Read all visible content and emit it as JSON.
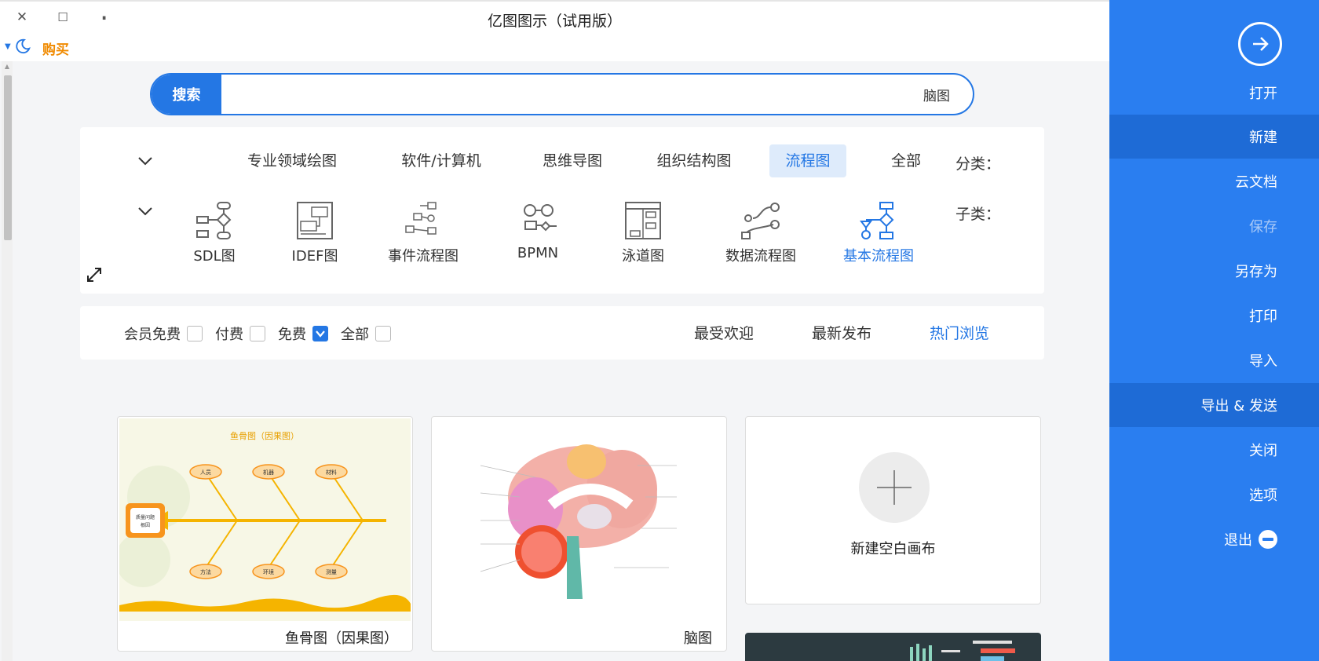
{
  "window": {
    "title": "亿图图示（试用版）",
    "close_glyph": "✕",
    "maximize_glyph": "☐",
    "minimize_glyph": "▬"
  },
  "menu": {
    "buy_label": "购买",
    "theme_icon": "moon-icon"
  },
  "search": {
    "button_label": "搜索",
    "value": "脑图"
  },
  "category": {
    "label": "分类：",
    "items": [
      "全部",
      "流程图",
      "组织结构图",
      "思维导图",
      "软件/计算机",
      "专业领域绘图"
    ],
    "active": "流程图"
  },
  "subcategory": {
    "label": "子类：",
    "items": [
      "基本流程图",
      "数据流程图",
      "泳道图",
      "BPMN",
      "事件流程图",
      "IDEF图",
      "SDL图"
    ],
    "active": "基本流程图"
  },
  "sort": {
    "items": [
      "热门浏览",
      "最新发布",
      "最受欢迎"
    ],
    "active": "热门浏览"
  },
  "price_filter": {
    "items": [
      "全部",
      "免费",
      "付费",
      "会员免费"
    ],
    "checked": "免费"
  },
  "cards": {
    "new_blank": "新建空白画布",
    "brain": "脑图",
    "fishbone": "鱼骨图（因果图）",
    "fishbone_title": "鱼骨图（因果图）",
    "fishbone_head": [
      "质量问题",
      "根因"
    ],
    "fishbone_bubbles": [
      "人员",
      "机器",
      "材料",
      "方法",
      "环境",
      "测量"
    ]
  },
  "sidebar": {
    "open_label": "打开",
    "new_label": "新建",
    "cloud_label": "云文档",
    "save_label": "保存",
    "save_as_label": "另存为",
    "print_label": "打印",
    "import_label": "导入",
    "export_label": "导出 & 发送",
    "close_label": "关闭",
    "options_label": "选项",
    "exit_label": "退出"
  },
  "colors": {
    "accent": "#2477e4",
    "sidebar": "#2a7ef0",
    "sidebar_highlight": "#1e6bd6",
    "buy": "#f08a00",
    "active_bg": "#deebfb"
  }
}
